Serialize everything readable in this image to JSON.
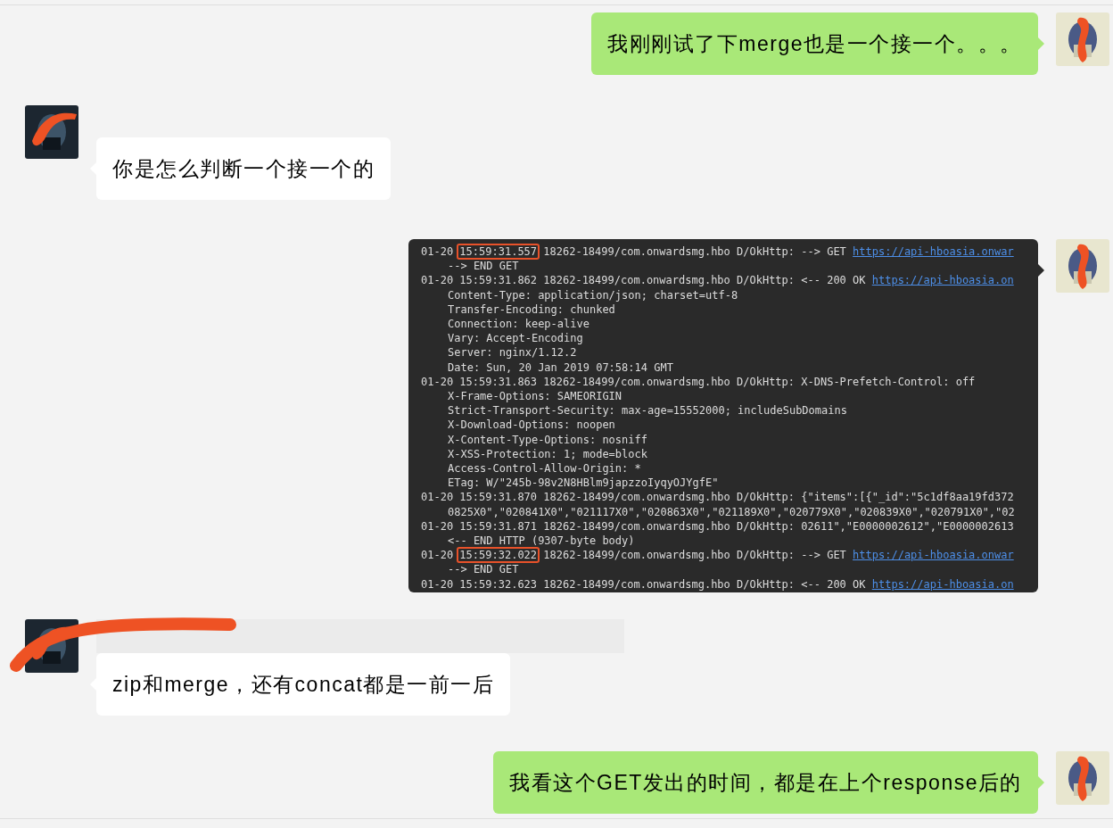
{
  "messages": [
    {
      "outgoing": true,
      "kind": "text",
      "text": "我刚刚试了下merge也是一个接一个。。。"
    },
    {
      "outgoing": false,
      "kind": "text",
      "name_hidden": false,
      "text": "你是怎么判断一个接一个的"
    },
    {
      "outgoing": true,
      "kind": "log",
      "lines": [
        {
          "kind": "entry",
          "date": "01-20",
          "time": "15:59:31.557",
          "marked": true,
          "rest": "18262-18499/com.onwardsmg.hbo D/OkHttp: --> GET ",
          "link": "https://api-hboasia.onwar"
        },
        {
          "kind": "detail",
          "text": "--> END GET"
        },
        {
          "kind": "entry",
          "date": "01-20",
          "time": "15:59:31.862",
          "marked": false,
          "rest": "18262-18499/com.onwardsmg.hbo D/OkHttp: <-- 200 OK ",
          "link": "https://api-hboasia.on"
        },
        {
          "kind": "detail",
          "text": "Content-Type: application/json; charset=utf-8"
        },
        {
          "kind": "detail",
          "text": "Transfer-Encoding: chunked"
        },
        {
          "kind": "detail",
          "text": "Connection: keep-alive"
        },
        {
          "kind": "detail",
          "text": "Vary: Accept-Encoding"
        },
        {
          "kind": "detail",
          "text": "Server: nginx/1.12.2"
        },
        {
          "kind": "detail",
          "text": "Date: Sun, 20 Jan 2019 07:58:14 GMT"
        },
        {
          "kind": "entry",
          "date": "01-20",
          "time": "15:59:31.863",
          "marked": false,
          "rest": "18262-18499/com.onwardsmg.hbo D/OkHttp: X-DNS-Prefetch-Control: off"
        },
        {
          "kind": "detail",
          "text": "X-Frame-Options: SAMEORIGIN"
        },
        {
          "kind": "detail",
          "text": "Strict-Transport-Security: max-age=15552000; includeSubDomains"
        },
        {
          "kind": "detail",
          "text": "X-Download-Options: noopen"
        },
        {
          "kind": "detail",
          "text": "X-Content-Type-Options: nosniff"
        },
        {
          "kind": "detail",
          "text": "X-XSS-Protection: 1; mode=block"
        },
        {
          "kind": "detail",
          "text": "Access-Control-Allow-Origin: *"
        },
        {
          "kind": "detail",
          "text": "ETag: W/\"245b-98v2N8HBlm9japzzoIyqyOJYgfE\""
        },
        {
          "kind": "entry",
          "date": "01-20",
          "time": "15:59:31.870",
          "marked": false,
          "rest": "18262-18499/com.onwardsmg.hbo D/OkHttp: {\"items\":[{\"_id\":\"5c1df8aa19fd372"
        },
        {
          "kind": "detail",
          "text": "0825X0\",\"020841X0\",\"021117X0\",\"020863X0\",\"021189X0\",\"020779X0\",\"020839X0\",\"020791X0\",\"02"
        },
        {
          "kind": "entry",
          "date": "01-20",
          "time": "15:59:31.871",
          "marked": false,
          "rest": "18262-18499/com.onwardsmg.hbo D/OkHttp: 02611\",\"E0000002612\",\"E0000002613"
        },
        {
          "kind": "detail",
          "text": "<-- END HTTP (9307-byte body)"
        },
        {
          "kind": "entry",
          "date": "01-20",
          "time": "15:59:32.022",
          "marked": true,
          "rest": "18262-18499/com.onwardsmg.hbo D/OkHttp: --> GET ",
          "link": "https://api-hboasia.onwar"
        },
        {
          "kind": "detail",
          "text": "--> END GET"
        },
        {
          "kind": "entry",
          "date": "01-20",
          "time": "15:59:32.623",
          "marked": false,
          "rest": "18262-18499/com.onwardsmg.hbo D/OkHttp: <-- 200 OK ",
          "link": "https://api-hboasia.on"
        }
      ]
    },
    {
      "outgoing": false,
      "kind": "text",
      "name_hidden": true,
      "text": "zip和merge，还有concat都是一前一后"
    },
    {
      "outgoing": true,
      "kind": "text",
      "text": "我看这个GET发出的时间，都是在上个response后的"
    }
  ]
}
